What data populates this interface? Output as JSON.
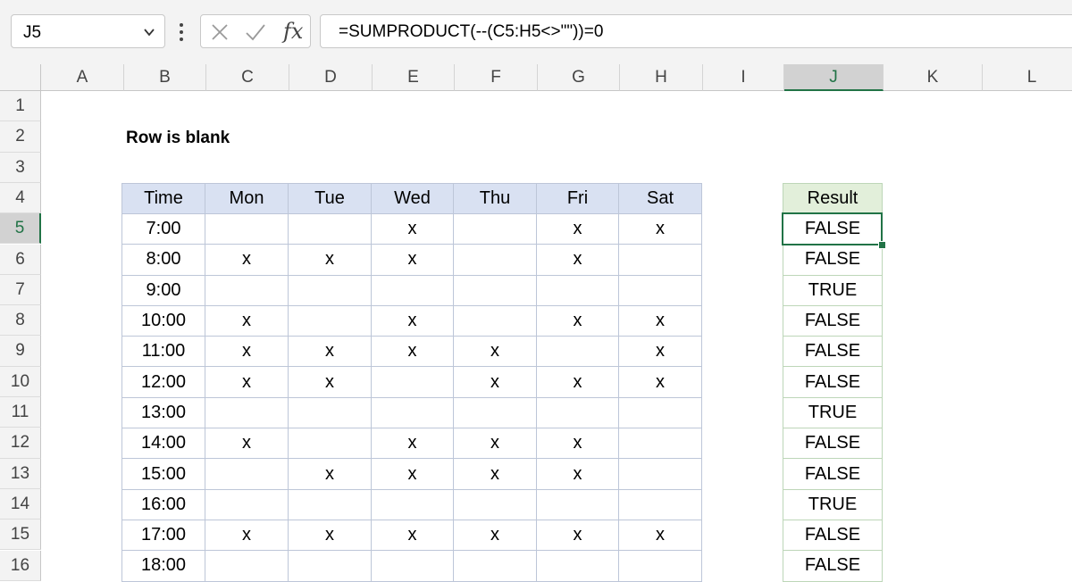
{
  "formula_bar": {
    "name_box": "J5",
    "fx_label": "fx",
    "formula": "=SUMPRODUCT(--(C5:H5<>\"\"))=0"
  },
  "columns": [
    {
      "label": "A",
      "w": 93
    },
    {
      "label": "B",
      "w": 92
    },
    {
      "label": "C",
      "w": 93
    },
    {
      "label": "D",
      "w": 93
    },
    {
      "label": "E",
      "w": 92
    },
    {
      "label": "F",
      "w": 93
    },
    {
      "label": "G",
      "w": 92
    },
    {
      "label": "H",
      "w": 93
    },
    {
      "label": "I",
      "w": 91
    },
    {
      "label": "J",
      "w": 111
    },
    {
      "label": "K",
      "w": 111
    },
    {
      "label": "L",
      "w": 111
    }
  ],
  "rows": [
    "1",
    "2",
    "3",
    "4",
    "5",
    "6",
    "7",
    "8",
    "9",
    "10",
    "11",
    "12",
    "13",
    "14",
    "15",
    "16"
  ],
  "selected_column": "J",
  "selected_row": "5",
  "sheet": {
    "title": "Row is blank",
    "table": {
      "headers": [
        "Time",
        "Mon",
        "Tue",
        "Wed",
        "Thu",
        "Fri",
        "Sat"
      ],
      "rows": [
        [
          "7:00",
          "",
          "",
          "x",
          "",
          "x",
          "x"
        ],
        [
          "8:00",
          "x",
          "x",
          "x",
          "",
          "x",
          ""
        ],
        [
          "9:00",
          "",
          "",
          "",
          "",
          "",
          ""
        ],
        [
          "10:00",
          "x",
          "",
          "x",
          "",
          "x",
          "x"
        ],
        [
          "11:00",
          "x",
          "x",
          "x",
          "x",
          "",
          "x"
        ],
        [
          "12:00",
          "x",
          "x",
          "",
          "x",
          "x",
          "x"
        ],
        [
          "13:00",
          "",
          "",
          "",
          "",
          "",
          ""
        ],
        [
          "14:00",
          "x",
          "",
          "x",
          "x",
          "x",
          ""
        ],
        [
          "15:00",
          "",
          "x",
          "x",
          "x",
          "x",
          ""
        ],
        [
          "16:00",
          "",
          "",
          "",
          "",
          "",
          ""
        ],
        [
          "17:00",
          "x",
          "x",
          "x",
          "x",
          "x",
          "x"
        ],
        [
          "18:00",
          "",
          "",
          "",
          "",
          "",
          ""
        ]
      ]
    },
    "result": {
      "header": "Result",
      "values": [
        "FALSE",
        "FALSE",
        "TRUE",
        "FALSE",
        "FALSE",
        "FALSE",
        "TRUE",
        "FALSE",
        "FALSE",
        "TRUE",
        "FALSE",
        "FALSE"
      ]
    }
  },
  "colors": {
    "accent": "#217346",
    "table_header": "#d9e1f2",
    "result_header": "#e2efda"
  }
}
